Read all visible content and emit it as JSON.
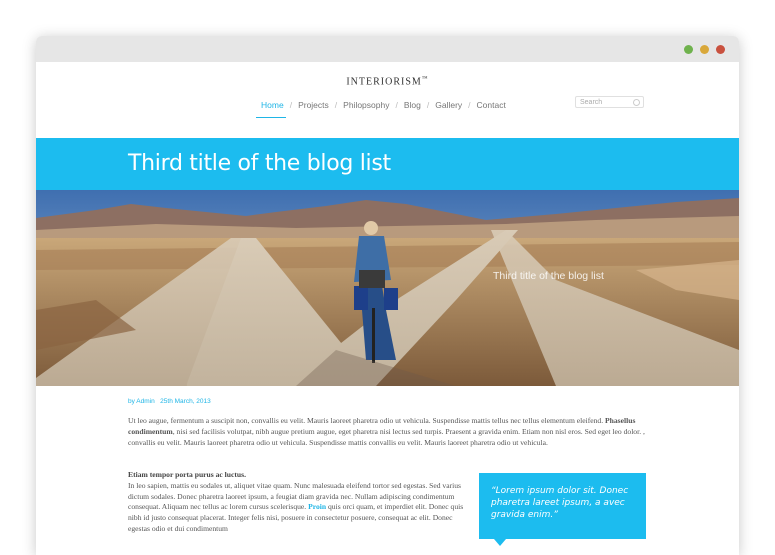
{
  "window": {
    "dot_colors": [
      "#6fb24d",
      "#d9a83a",
      "#c9513f"
    ]
  },
  "site": {
    "logo": "INTERIORISM",
    "logo_tm": "™"
  },
  "nav": {
    "items": [
      "Home",
      "Projects",
      "Philopsophy",
      "Blog",
      "Gallery",
      "Contact"
    ],
    "separator": "/",
    "active": "Home",
    "accent_color": "#1fb5e6"
  },
  "search": {
    "placeholder": "Search",
    "icon": "search-icon"
  },
  "post": {
    "title": "Third title of the blog list",
    "image_caption": "Third title of the blog list",
    "meta_author": "by Admin",
    "meta_date": "25th March, 2013",
    "para1_a": "Ut leo augue, fermentum a suscipit non, convallis eu velit. Mauris laoreet pharetra odio ut vehicula. Suspendisse mattis tellus nec tellus elementum eleifend. ",
    "para1_bold": "Phasellus condimentum",
    "para1_b": ", nisi sed facilisis volutpat, nibh augue pretium augue, eget pharetra nisi lectus sed turpis. Praesent a gravida enim. Etiam non nisl eros. Sed eget leo dolor. , convallis eu velit. Mauris laoreet pharetra odio ut vehicula. Suspendisse mattis convallis eu velit. Mauris laoreet pharetra odio ut vehicula.",
    "para2_heading": "Etiam tempor porta purus ac luctus.",
    "para2_a": "In leo sapien, mattis eu sodales ut, aliquet vitae quam. Nunc malesuada eleifend tortor sed egestas. Sed varius dictum sodales. Donec pharetra laoreet ipsum, a feugiat diam gravida nec. Nullam adipiscing condimentum consequat. Aliquam nec tellus ac lorem cursus scelerisque. ",
    "para2_link": "Proin",
    "para2_b": " quis orci quam, et imperdiet elit. Donec quis nibh id justo consequat placerat. Integer felis nisi, posuere in consectetur posuere, consequat ac elit. Donec egestas odio et dui condimentum",
    "quote": "“Lorem ipsum dolor sit. Donec pharetra lareet ipsum, a avec gravida enim.”",
    "accent_color": "#1cbcef"
  }
}
